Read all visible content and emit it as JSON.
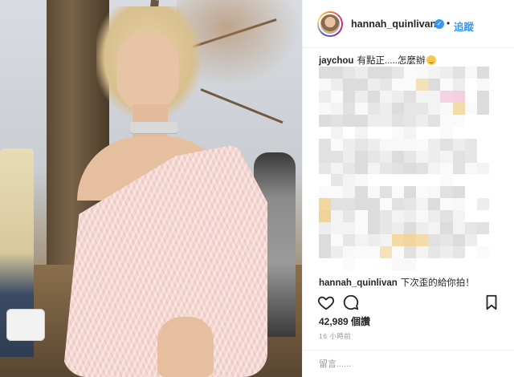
{
  "post": {
    "username": "hannah_quinlivan",
    "verified_icon": "verified-badge-icon",
    "separator": "•",
    "follow_label": "追蹤"
  },
  "comments": [
    {
      "user": "jaychou",
      "text": "有點正.....怎麼辦",
      "emoji": "grinning-sweat-emoji"
    },
    {
      "user": "hannah_quinlivan",
      "text": "下次歪的給你拍！"
    }
  ],
  "actions": {
    "like_icon": "heart-icon",
    "comment_icon": "comment-bubble-icon",
    "save_icon": "bookmark-icon"
  },
  "likes_text": "42,989 個讚",
  "timestamp": "16 小時前",
  "add_comment_placeholder": "留言......",
  "colors": {
    "link_blue": "#3897f0",
    "text": "#262626",
    "muted": "#999999",
    "border": "#efefef"
  }
}
